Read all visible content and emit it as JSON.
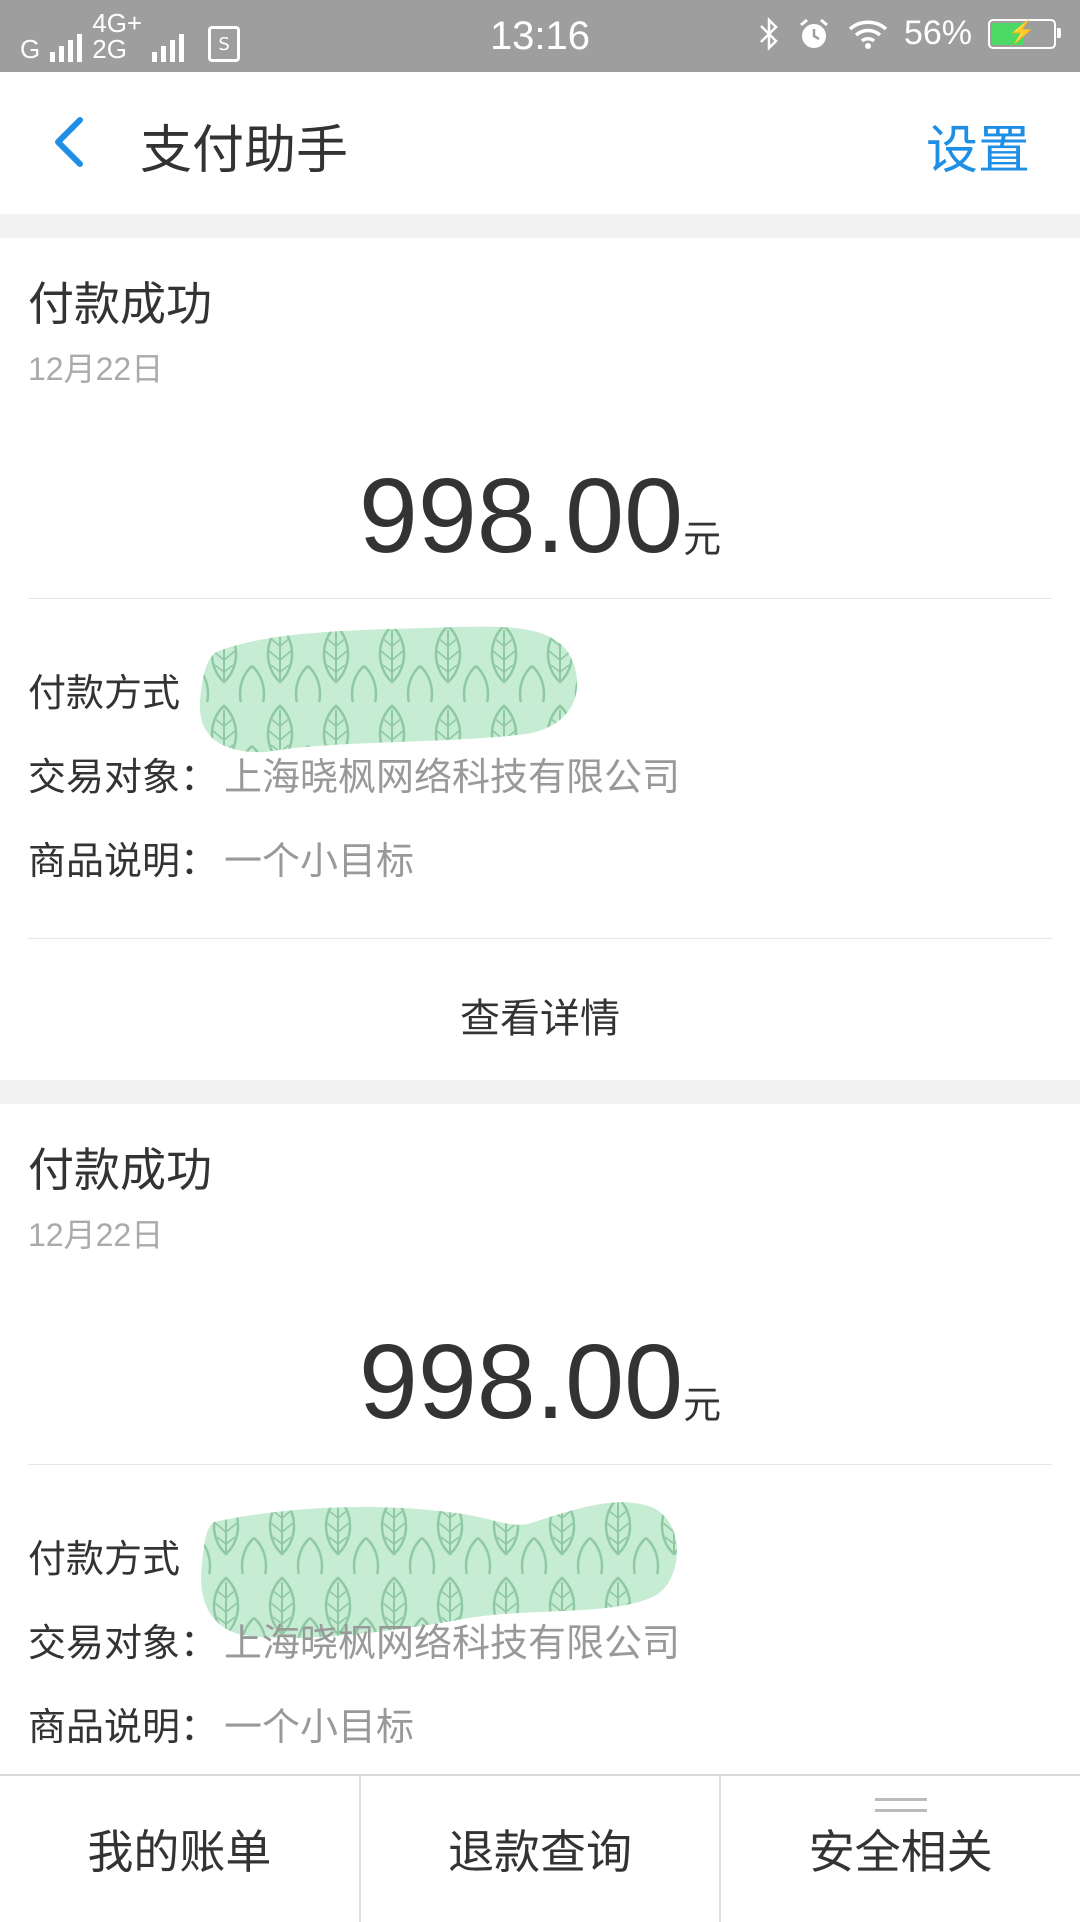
{
  "status_bar": {
    "net1": "G",
    "net2_top": "4G+",
    "net2_bottom": "2G",
    "time": "13:16",
    "battery": "56%",
    "battery_level": 0.56
  },
  "nav": {
    "title": "支付助手",
    "settings": "设置"
  },
  "cards": [
    {
      "title": "付款成功",
      "date": "12月22日",
      "amount": "998.00",
      "unit": "元",
      "pay_method_label": "付款方式",
      "counterparty_label": "交易对象：",
      "counterparty_value": "上海晓枫网络科技有限公司",
      "item_label": "商品说明：",
      "item_value": "一个小目标",
      "detail_link": "查看详情"
    },
    {
      "title": "付款成功",
      "date": "12月22日",
      "amount": "998.00",
      "unit": "元",
      "pay_method_label": "付款方式",
      "counterparty_label": "交易对象：",
      "counterparty_value": "上海晓枫网络科技有限公司",
      "item_label": "商品说明：",
      "item_value": "一个小目标"
    }
  ],
  "bottom_tabs": [
    {
      "label": "我的账单"
    },
    {
      "label": "退款查询"
    },
    {
      "label": "安全相关"
    }
  ],
  "colors": {
    "accent": "#1f8fe5",
    "status_bar": "#9e9e9e",
    "mask": "#c6ecd3"
  }
}
